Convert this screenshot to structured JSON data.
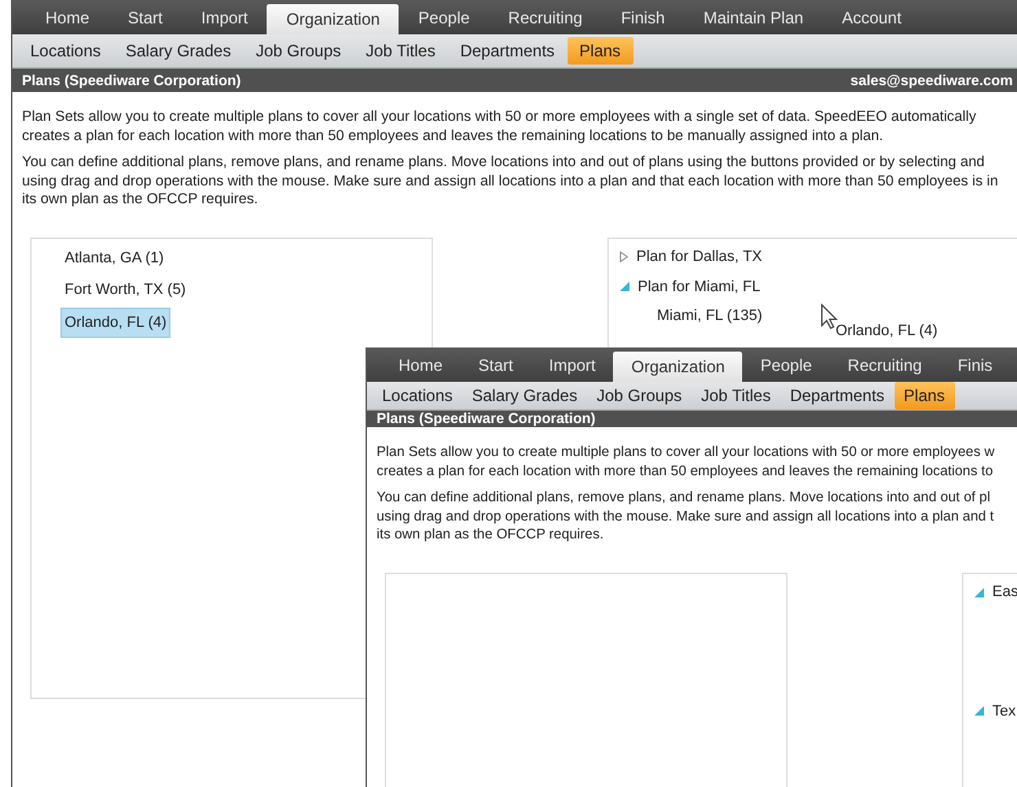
{
  "back_window": {
    "menu_tabs": [
      {
        "label": "Home",
        "selected": false
      },
      {
        "label": "Start",
        "selected": false
      },
      {
        "label": "Import",
        "selected": false
      },
      {
        "label": "Organization",
        "selected": true
      },
      {
        "label": "People",
        "selected": false
      },
      {
        "label": "Recruiting",
        "selected": false
      },
      {
        "label": "Finish",
        "selected": false
      },
      {
        "label": "Maintain Plan",
        "selected": false
      },
      {
        "label": "Account",
        "selected": false
      }
    ],
    "sub_tabs": [
      {
        "label": "Locations",
        "selected": false
      },
      {
        "label": "Salary Grades",
        "selected": false
      },
      {
        "label": "Job Groups",
        "selected": false
      },
      {
        "label": "Job Titles",
        "selected": false
      },
      {
        "label": "Departments",
        "selected": false
      },
      {
        "label": "Plans",
        "selected": true
      }
    ],
    "header": {
      "title": "Plans (Speediware Corporation)",
      "email": "sales@speediware.com"
    },
    "paragraphs": [
      [
        "Plan Sets allow you to create multiple plans to cover all your locations with 50 or more employees with a single set of data. SpeedEEO automatically",
        "creates a plan for each location with more than 50 employees and leaves the remaining locations to be manually assigned into a plan."
      ],
      [
        "You can define additional plans, remove plans, and rename plans. Move locations into and out of plans using the buttons provided or by selecting and",
        "using drag and drop operations with the mouse. Make sure and assign all locations into a plan and that each location with more than 50 employees is in",
        "its own plan as the OFCCP requires."
      ]
    ],
    "locations": [
      {
        "label": "Atlanta, GA (1)",
        "selected": false
      },
      {
        "label": "Fort Worth, TX (5)",
        "selected": false
      },
      {
        "label": "Orlando, FL (4)",
        "selected": true
      }
    ],
    "plans": [
      {
        "label": "Plan for Dallas, TX",
        "expanded": false
      },
      {
        "label": "Plan for Miami, FL",
        "expanded": true,
        "children": [
          {
            "label": "Miami, FL (135)"
          }
        ]
      }
    ],
    "drag_label": "Orlando, FL (4)"
  },
  "front_window": {
    "menu_tabs": [
      {
        "label": "Home",
        "selected": false
      },
      {
        "label": "Start",
        "selected": false
      },
      {
        "label": "Import",
        "selected": false
      },
      {
        "label": "Organization",
        "selected": true
      },
      {
        "label": "People",
        "selected": false
      },
      {
        "label": "Recruiting",
        "selected": false
      },
      {
        "label": "Finis",
        "selected": false
      }
    ],
    "sub_tabs": [
      {
        "label": "Locations",
        "selected": false
      },
      {
        "label": "Salary Grades",
        "selected": false
      },
      {
        "label": "Job Groups",
        "selected": false
      },
      {
        "label": "Job Titles",
        "selected": false
      },
      {
        "label": "Departments",
        "selected": false
      },
      {
        "label": "Plans",
        "selected": true
      }
    ],
    "header": {
      "title": "Plans (Speediware Corporation)"
    },
    "paragraphs": [
      [
        "Plan Sets allow you to create multiple plans to cover all your locations with 50 or more employees w",
        "creates a plan for each location with more than 50 employees and leaves the remaining locations to"
      ],
      [
        "You can define additional plans, remove plans, and rename plans. Move locations into and out of pl",
        "using drag and drop operations with the mouse. Make sure and assign all locations into a plan and t",
        "its own plan as the OFCCP requires."
      ]
    ],
    "plans": [
      {
        "label": "Eas",
        "expanded": true
      },
      {
        "label": "Tex",
        "expanded": true
      }
    ]
  }
}
